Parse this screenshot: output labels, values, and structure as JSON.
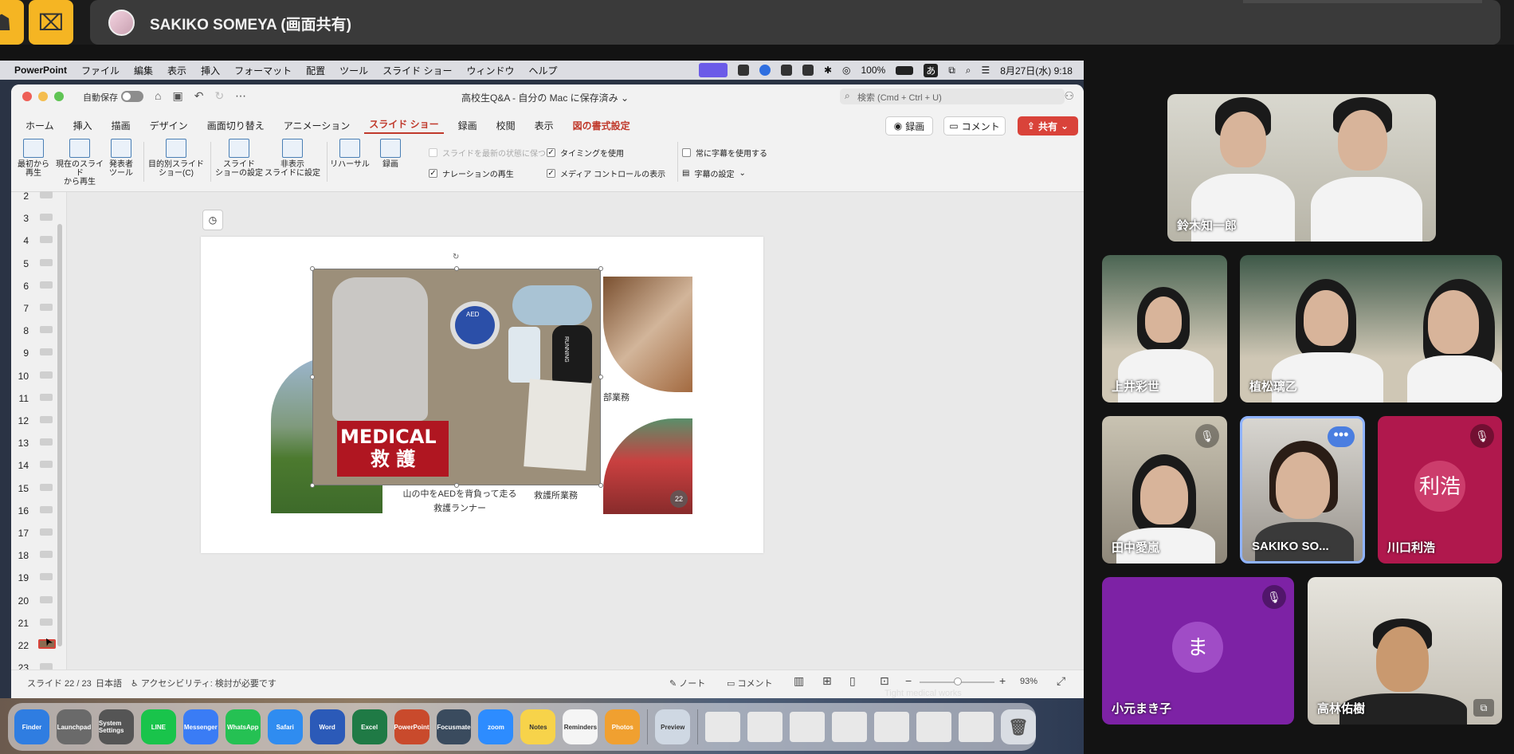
{
  "meeting": {
    "share_title": "SAKIKO SOMEYA (画面共有)",
    "tile_participant_icon": "person-icon",
    "tile_room_icon": "room-icon"
  },
  "mac_menubar": {
    "app": "PowerPoint",
    "menus": [
      "ファイル",
      "編集",
      "表示",
      "挿入",
      "フォーマット",
      "配置",
      "ツール",
      "スライド ショー",
      "ウィンドウ",
      "ヘルプ"
    ],
    "battery": "100%",
    "ime": "あ",
    "clock": "8月27日(水) 9:18"
  },
  "ppt": {
    "autosave_label": "自動保存",
    "doc_title": "高校生Q&A - 自分の Mac に保存済み ⌄",
    "search_placeholder": "検索 (Cmd + Ctrl + U)",
    "tabs": [
      "ホーム",
      "挿入",
      "描画",
      "デザイン",
      "画面切り替え",
      "アニメーション",
      "スライド ショー",
      "録画",
      "校閲",
      "表示",
      "図の書式設定"
    ],
    "record_label": "録画",
    "comment_label": "コメント",
    "share_label": "共有",
    "ribbon": {
      "from_start": [
        "最初から",
        "再生"
      ],
      "from_current": [
        "現在のスライド",
        "から再生"
      ],
      "presenter": [
        "発表者",
        "ツール"
      ],
      "custom": [
        "目的別スライド",
        "ショー(C)"
      ],
      "setup": [
        "スライド",
        "ショーの設定"
      ],
      "hide": [
        "非表示",
        "スライドに設定"
      ],
      "rehearse": "リハーサル",
      "record": "録画",
      "keep_updated": "スライドを最新の状態に保つ",
      "use_timing": "タイミングを使用",
      "play_narration": "ナレーションの再生",
      "show_media": "メディア コントロールの表示",
      "always_subtitles": "常に字幕を使用する",
      "subtitle_settings": "字幕の設定"
    },
    "thumbnails": [
      "2",
      "3",
      "4",
      "5",
      "6",
      "7",
      "8",
      "9",
      "10",
      "11",
      "12",
      "13",
      "14",
      "15",
      "16",
      "17",
      "18",
      "19",
      "20",
      "21",
      "22",
      "23"
    ],
    "slide": {
      "caption_main": [
        "山の中をAEDを背負って走る",
        "救護ランナー"
      ],
      "caption_right": "救護所業務",
      "caption_top_right": "部業務",
      "vest_text": [
        "MEDICAL",
        "救 護"
      ],
      "bag_text": "RUNNING",
      "aed_text": "AED",
      "page_badge": "22"
    },
    "status": {
      "slide_pos": "スライド 22 / 23",
      "lang": "日本語",
      "accessibility": "アクセシビリティ: 検討が必要です",
      "notes": "ノート",
      "comments": "コメント",
      "zoom": "93%"
    }
  },
  "desktop": {
    "caption": "Tight medical works",
    "dock_apps": [
      "Finder",
      "Launchpad",
      "System Settings",
      "LINE",
      "Messenger",
      "WhatsApp",
      "Safari",
      "Word",
      "Excel",
      "PowerPoint",
      "Focusmate",
      "zoom",
      "Notes",
      "Reminders",
      "Photos",
      "Preview"
    ]
  },
  "participants": [
    {
      "name": "鈴木知一郎",
      "muted": false
    },
    {
      "name": "上井彩世",
      "muted": false
    },
    {
      "name": "植松璃乙",
      "muted": false
    },
    {
      "name": "田中愛嵐",
      "muted": true
    },
    {
      "name": "SAKIKO SO...",
      "muted": false,
      "active": true
    },
    {
      "name": "川口利浩",
      "muted": true,
      "initial": "利浩",
      "bg": "#b0184d"
    },
    {
      "name": "小元まき子",
      "muted": true,
      "initial": "ま",
      "bg": "#7d22a5"
    },
    {
      "name": "高林佑樹",
      "muted": false
    }
  ],
  "colors": {
    "accent_red": "#d9433a",
    "zoom_yellow": "#f5b523",
    "active_border": "#8fb3ff"
  }
}
